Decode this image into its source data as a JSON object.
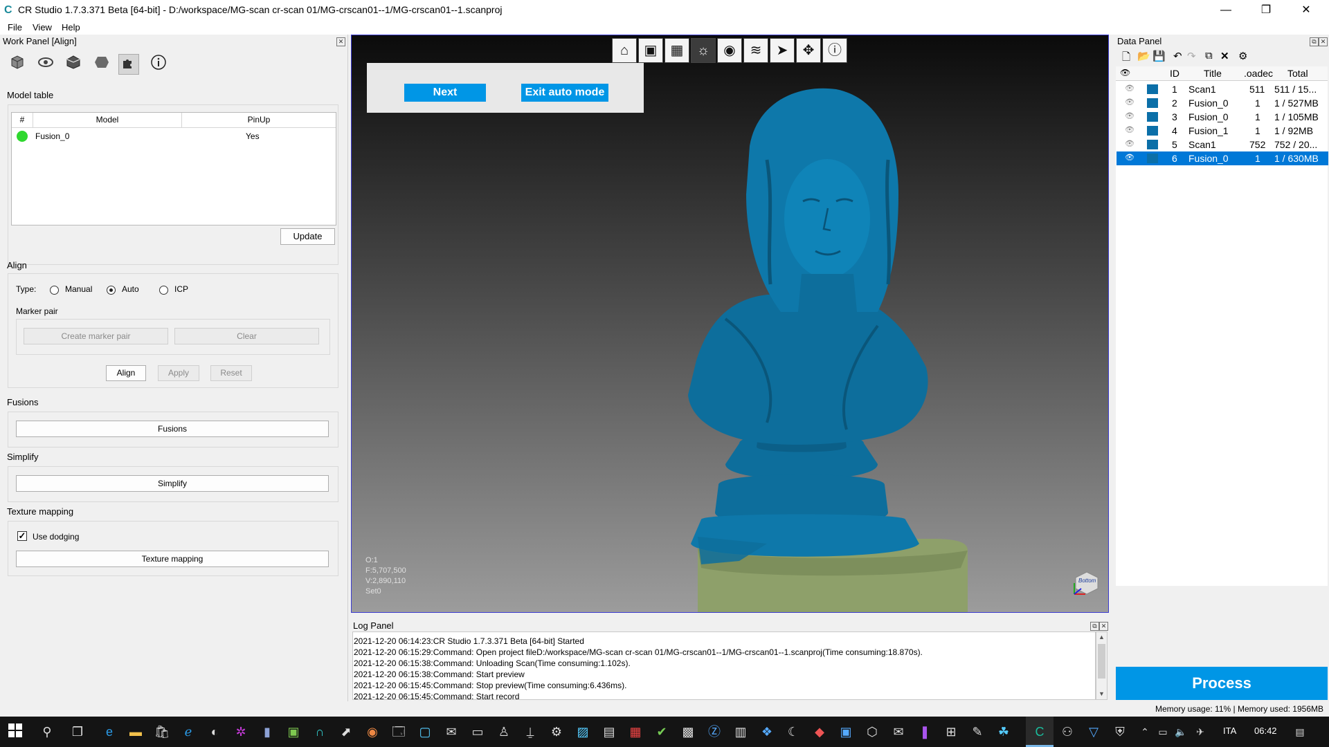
{
  "window": {
    "title": "CR Studio 1.7.3.371 Beta [64-bit] - D:/workspace/MG-scan cr-scan 01/MG-crscan01--1/MG-crscan01--1.scanproj",
    "minimize": "—",
    "maximize": "❐",
    "close": "✕"
  },
  "menu": [
    "File",
    "View",
    "Help"
  ],
  "work_panel": {
    "title": "Work Panel [Align]",
    "toolbar_icons": [
      "cube-icon",
      "eye-icon",
      "box-icon",
      "shape-icon",
      "puzzle-icon",
      "info-icon"
    ],
    "model_table_label": "Model table",
    "columns": [
      "#",
      "Model",
      "PinUp"
    ],
    "rows": [
      {
        "model": "Fusion_0",
        "pinup": "Yes",
        "status_color": "#2fd82f"
      }
    ],
    "update_btn": "Update",
    "align_label": "Align",
    "type_label": "Type:",
    "type_options": [
      "Manual",
      "Auto",
      "ICP"
    ],
    "type_selected": "Auto",
    "marker_pair_label": "Marker pair",
    "create_marker_pair": "Create marker pair",
    "clear": "Clear",
    "align_btn": "Align",
    "apply_btn": "Apply",
    "reset_btn": "Reset",
    "fusions_label": "Fusions",
    "fusions_btn": "Fusions",
    "simplify_label": "Simplify",
    "simplify_btn": "Simplify",
    "texture_label": "Texture mapping",
    "use_dodging": "Use dodging",
    "use_dodging_checked": true,
    "texture_btn": "Texture mapping"
  },
  "viewport": {
    "toolbar_icons": [
      "home-icon",
      "fit-view-icon",
      "render-mode-icon",
      "light-icon",
      "visibility-icon",
      "layers-icon",
      "select-icon",
      "move-icon",
      "info-icon"
    ],
    "next_btn": "Next",
    "exit_auto_btn": "Exit auto mode",
    "stats": [
      "O:1",
      "F:5,707,500",
      "V:2,890,110",
      "Set0"
    ],
    "axis_label": "Bottom",
    "mesh_color": "#0d6e9c",
    "base_color": "#8ea06a"
  },
  "data_panel": {
    "title": "Data Panel",
    "columns": [
      "ID",
      "Title",
      ".oadec",
      "Total"
    ],
    "rows": [
      {
        "id": "1",
        "title": "Scan1",
        "loaded": "511",
        "total": "511 / 15..."
      },
      {
        "id": "2",
        "title": "Fusion_0",
        "loaded": "1",
        "total": "1 / 527MB"
      },
      {
        "id": "3",
        "title": "Fusion_0",
        "loaded": "1",
        "total": "1 / 105MB"
      },
      {
        "id": "4",
        "title": "Fusion_1",
        "loaded": "1",
        "total": "1 / 92MB"
      },
      {
        "id": "5",
        "title": "Scan1",
        "loaded": "752",
        "total": "752 / 20..."
      },
      {
        "id": "6",
        "title": "Fusion_0",
        "loaded": "1",
        "total": "1 / 630MB"
      }
    ],
    "selected_row": "6",
    "process_btn": "Process",
    "accent": "#0096e6"
  },
  "log_panel": {
    "title": "Log Panel",
    "lines": [
      "2021-12-20 06:14:23:CR Studio 1.7.3.371 Beta [64-bit] Started",
      "2021-12-20 06:15:29:Command: Open project fileD:/workspace/MG-scan cr-scan 01/MG-crscan01--1/MG-crscan01--1.scanproj(Time consuming:18.870s).",
      "2021-12-20 06:15:38:Command: Unloading Scan(Time consuming:1.102s).",
      "2021-12-20 06:15:38:Command: Start preview",
      "2021-12-20 06:15:45:Command: Stop preview(Time consuming:6.436ms).",
      "2021-12-20 06:15:45:Command: Start record"
    ]
  },
  "status": {
    "memory": "Memory usage: 11% | Memory used: 1956MB"
  },
  "taskbar": {
    "language": "ITA",
    "time": "06:42"
  }
}
